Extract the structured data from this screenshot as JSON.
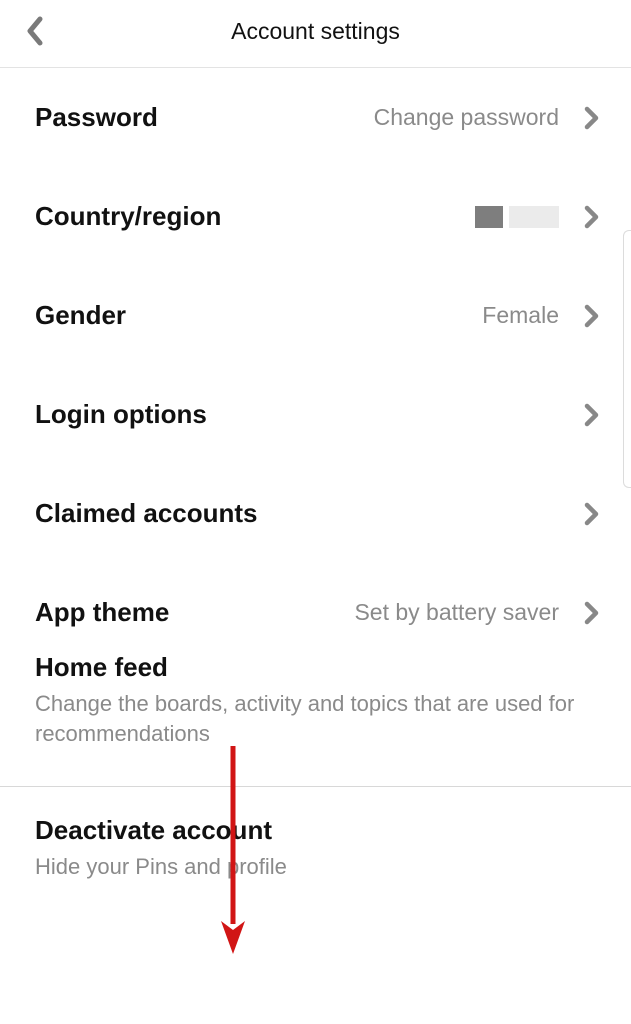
{
  "header": {
    "title": "Account settings"
  },
  "rows": {
    "password": {
      "label": "Password",
      "value": "Change password"
    },
    "country": {
      "label": "Country/region"
    },
    "gender": {
      "label": "Gender",
      "value": "Female"
    },
    "login": {
      "label": "Login options"
    },
    "claimed": {
      "label": "Claimed accounts"
    },
    "theme": {
      "label": "App theme",
      "value": "Set by battery saver"
    },
    "homefeed": {
      "label": "Home feed",
      "desc": "Change the boards, activity and topics that are used for recommendations"
    },
    "deactivate": {
      "label": "Deactivate account",
      "desc": "Hide your Pins and profile"
    }
  }
}
